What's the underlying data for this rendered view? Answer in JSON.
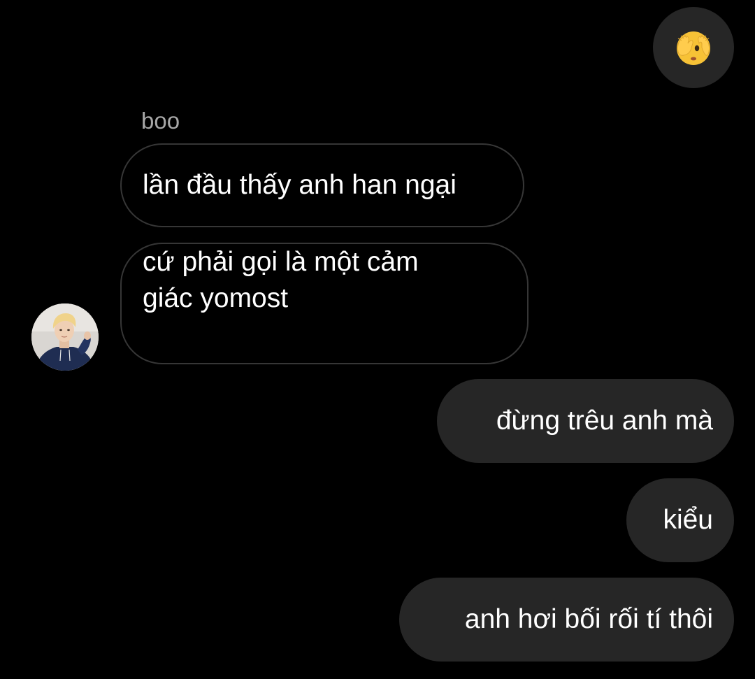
{
  "reaction": {
    "emoji_icon": "see-no-evil-face-emoji",
    "bubble_color": "#262626"
  },
  "thread": {
    "incoming": {
      "sender_name": "boo",
      "messages": [
        {
          "text": "lần đầu thấy anh han ngại"
        },
        {
          "lines": [
            "cứ phải gọi là một cảm",
            "giác yomost"
          ]
        }
      ],
      "avatar_icon": "contact-avatar-photo"
    },
    "outgoing": {
      "messages": [
        {
          "text": "đừng trêu anh mà"
        },
        {
          "text": "kiểu"
        },
        {
          "text": "anh hơi bối rối tí thôi"
        }
      ]
    }
  },
  "colors": {
    "background": "#000000",
    "outgoing_bubble": "#262626",
    "incoming_border": "#363636",
    "sender_name": "#a8a8a8"
  }
}
